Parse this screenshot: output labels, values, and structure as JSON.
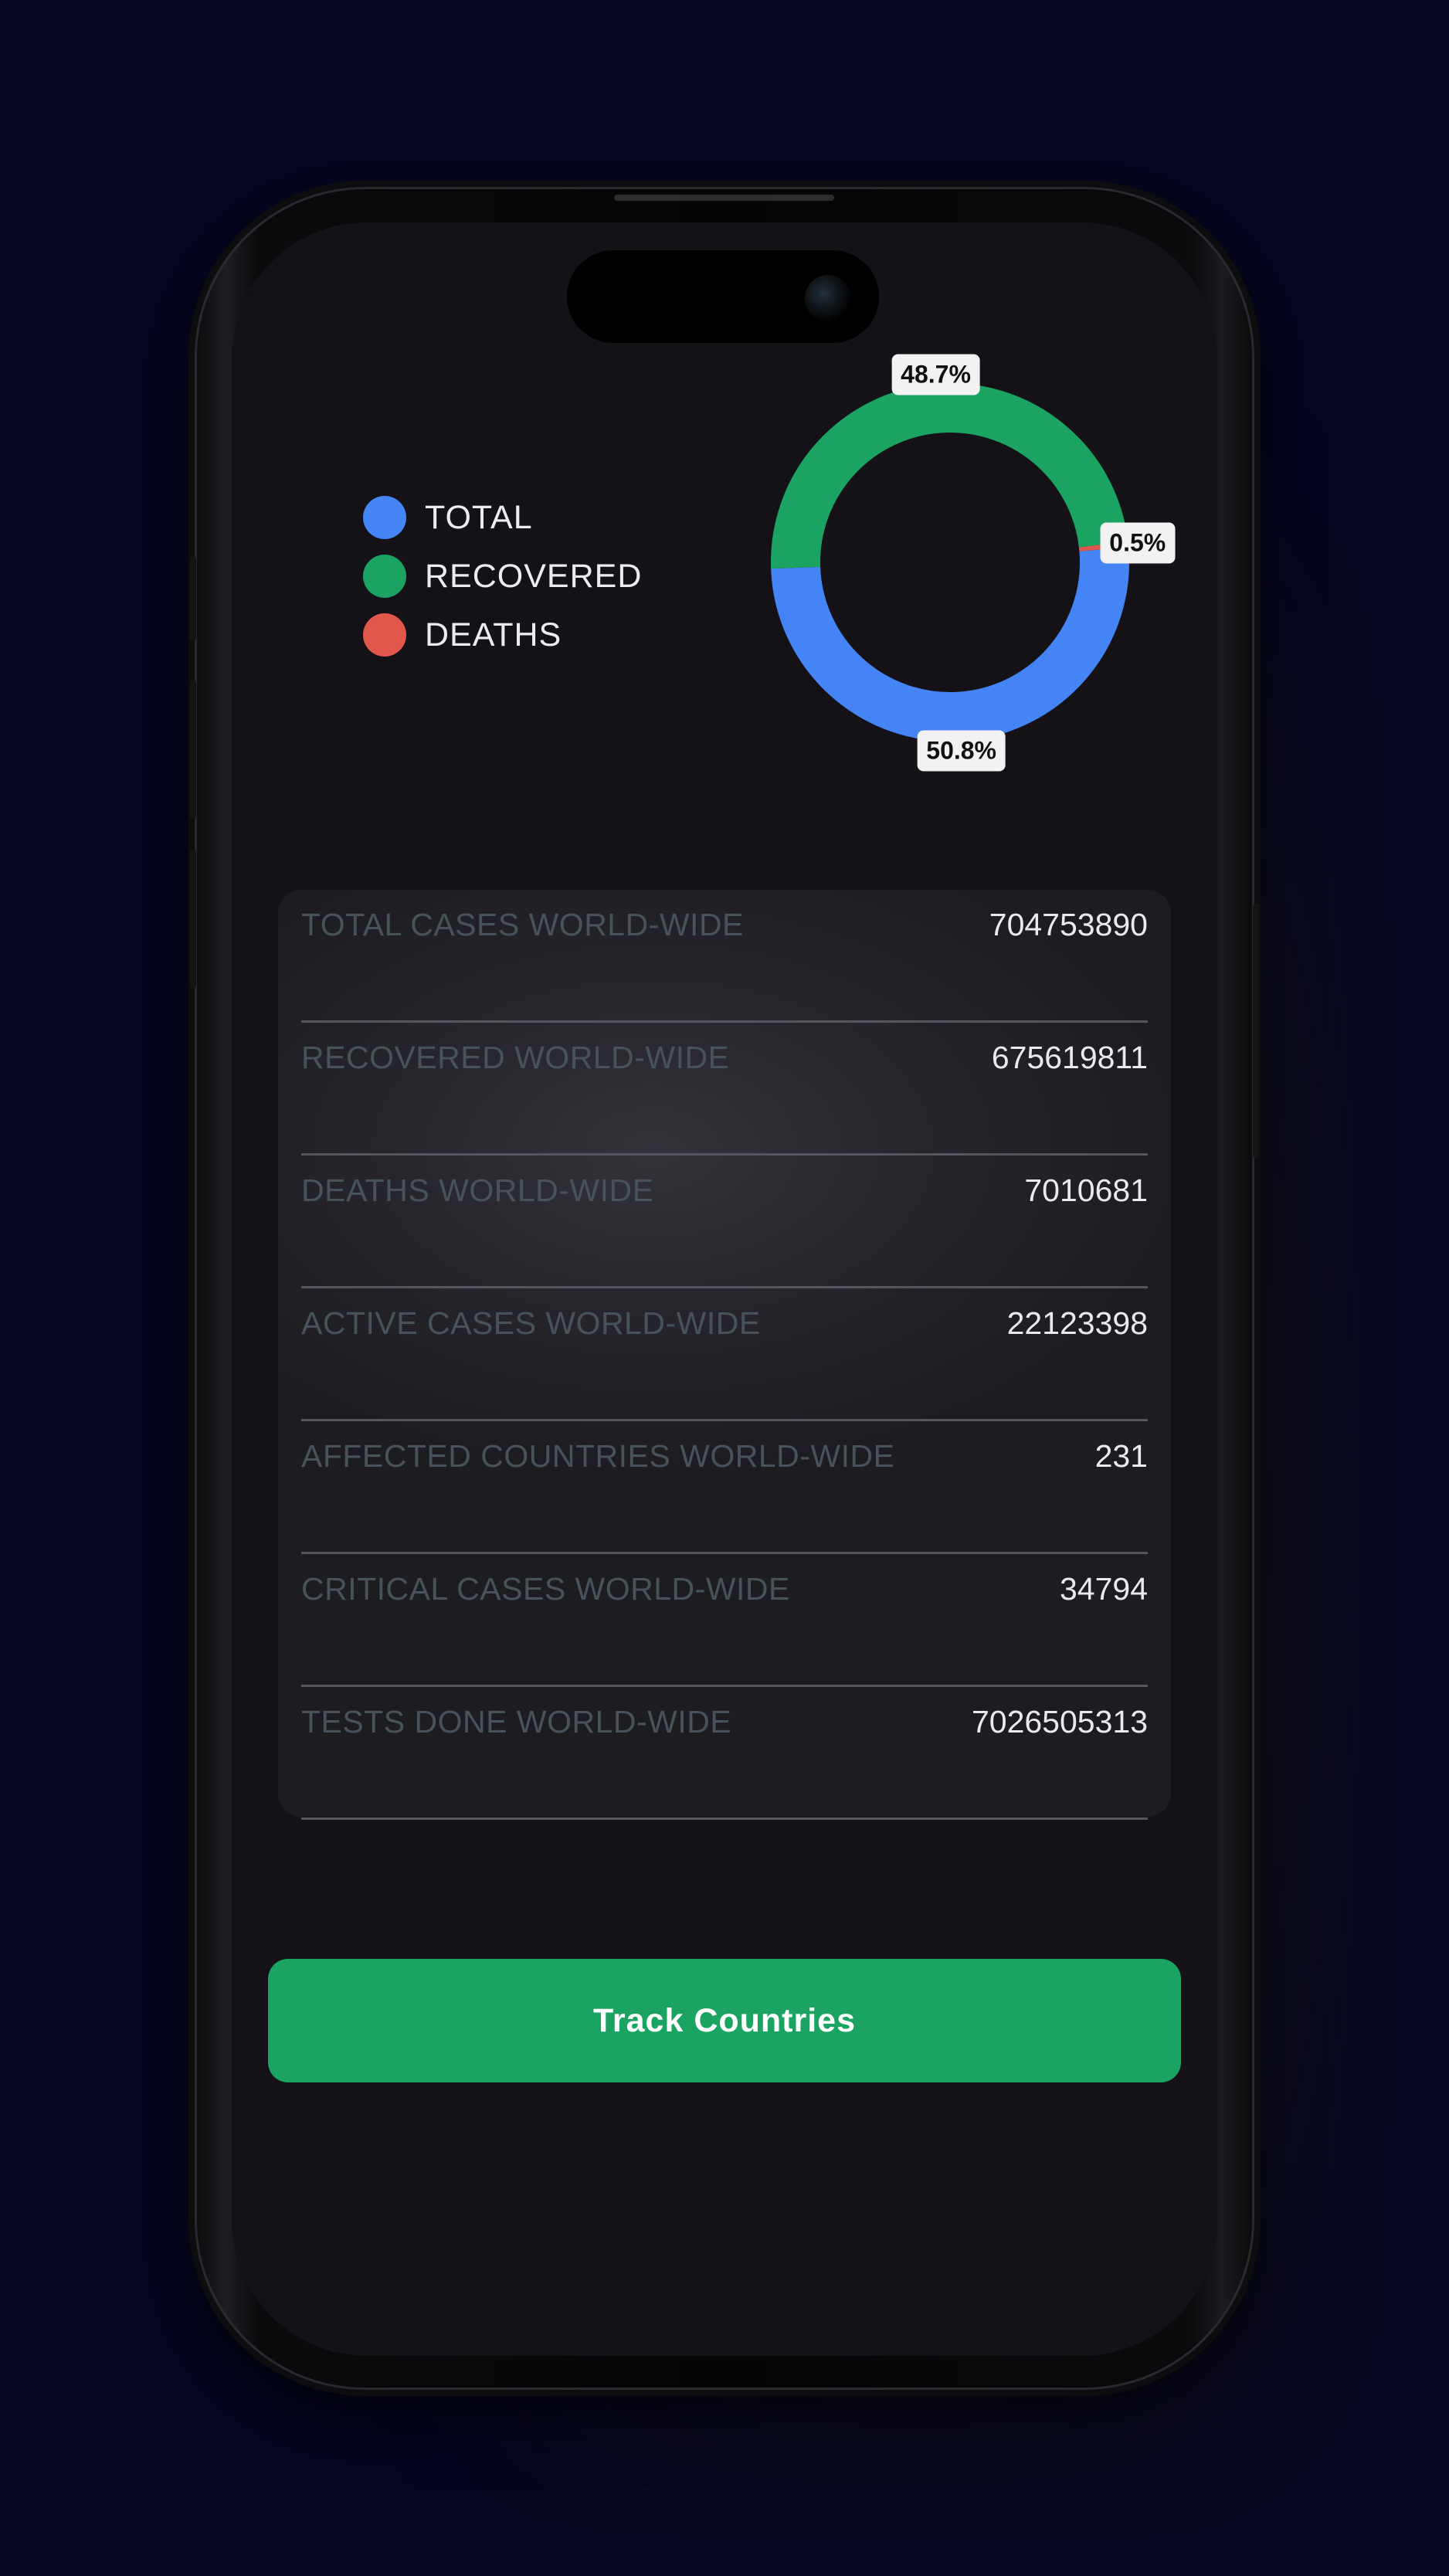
{
  "chart_data": {
    "type": "pie",
    "style": "donut",
    "series": [
      {
        "name": "TOTAL",
        "value": 50.8,
        "label": "50.8%",
        "color": "#4484f4"
      },
      {
        "name": "RECOVERED",
        "value": 48.7,
        "label": "48.7%",
        "color": "#1aa361"
      },
      {
        "name": "DEATHS",
        "value": 0.5,
        "label": "0.5%",
        "color": "#e2574c"
      }
    ],
    "legend_position": "left"
  },
  "legend": {
    "items": [
      {
        "label": "TOTAL",
        "color": "#4484f4"
      },
      {
        "label": "RECOVERED",
        "color": "#1aa361"
      },
      {
        "label": "DEATHS",
        "color": "#e2574c"
      }
    ]
  },
  "stats": {
    "rows": [
      {
        "label": "TOTAL CASES WORLD-WIDE",
        "value": "704753890"
      },
      {
        "label": "RECOVERED WORLD-WIDE",
        "value": "675619811"
      },
      {
        "label": "DEATHS WORLD-WIDE",
        "value": "7010681"
      },
      {
        "label": "ACTIVE CASES WORLD-WIDE",
        "value": "22123398"
      },
      {
        "label": "AFFECTED COUNTRIES WORLD-WIDE",
        "value": "231"
      },
      {
        "label": "CRITICAL CASES WORLD-WIDE",
        "value": "34794"
      },
      {
        "label": "TESTS DONE WORLD-WIDE",
        "value": "7026505313"
      }
    ]
  },
  "actions": {
    "track_label": "Track Countries",
    "track_color": "#1aa361"
  }
}
